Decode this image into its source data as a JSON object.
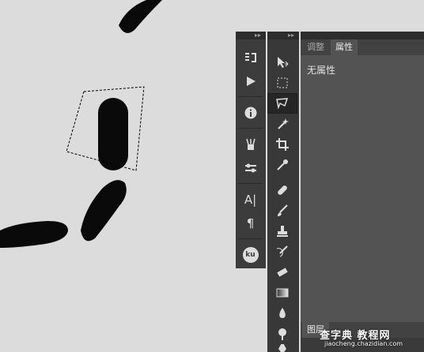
{
  "properties_panel": {
    "tabs": [
      {
        "label": "调整",
        "active": false
      },
      {
        "label": "属性",
        "active": true
      }
    ],
    "empty_text": "无属性"
  },
  "bottom_panel": {
    "tabs": [
      {
        "label": "图层"
      }
    ]
  },
  "watermark": {
    "title": "查字典 教程网",
    "url": "jiaocheng.chazidian.com"
  },
  "left_dock": {
    "icons": [
      "history-icon",
      "actions-play-icon",
      "info-icon",
      "brushes-icon",
      "brush-presets-icon",
      "character-icon",
      "paragraph-icon",
      "kuler-icon"
    ],
    "character_label": "A|",
    "paragraph_label": "¶",
    "kuler_label": "ku"
  },
  "toolbar": {
    "active_tool": "polygonal-lasso-tool",
    "tools": [
      "move-tool",
      "marquee-tool",
      "polygonal-lasso-tool",
      "magic-wand-tool",
      "crop-tool",
      "eyedropper-tool",
      "healing-brush-tool",
      "brush-tool",
      "clone-stamp-tool",
      "history-brush-tool",
      "eraser-tool",
      "gradient-tool",
      "blur-tool",
      "dodge-tool",
      "pen-tool"
    ]
  },
  "colors": {
    "canvas_bg": "#d9d9d9",
    "panel_dark": "#3c3c3c",
    "panel_mid": "#535353",
    "ink": "#0a0a0a"
  }
}
